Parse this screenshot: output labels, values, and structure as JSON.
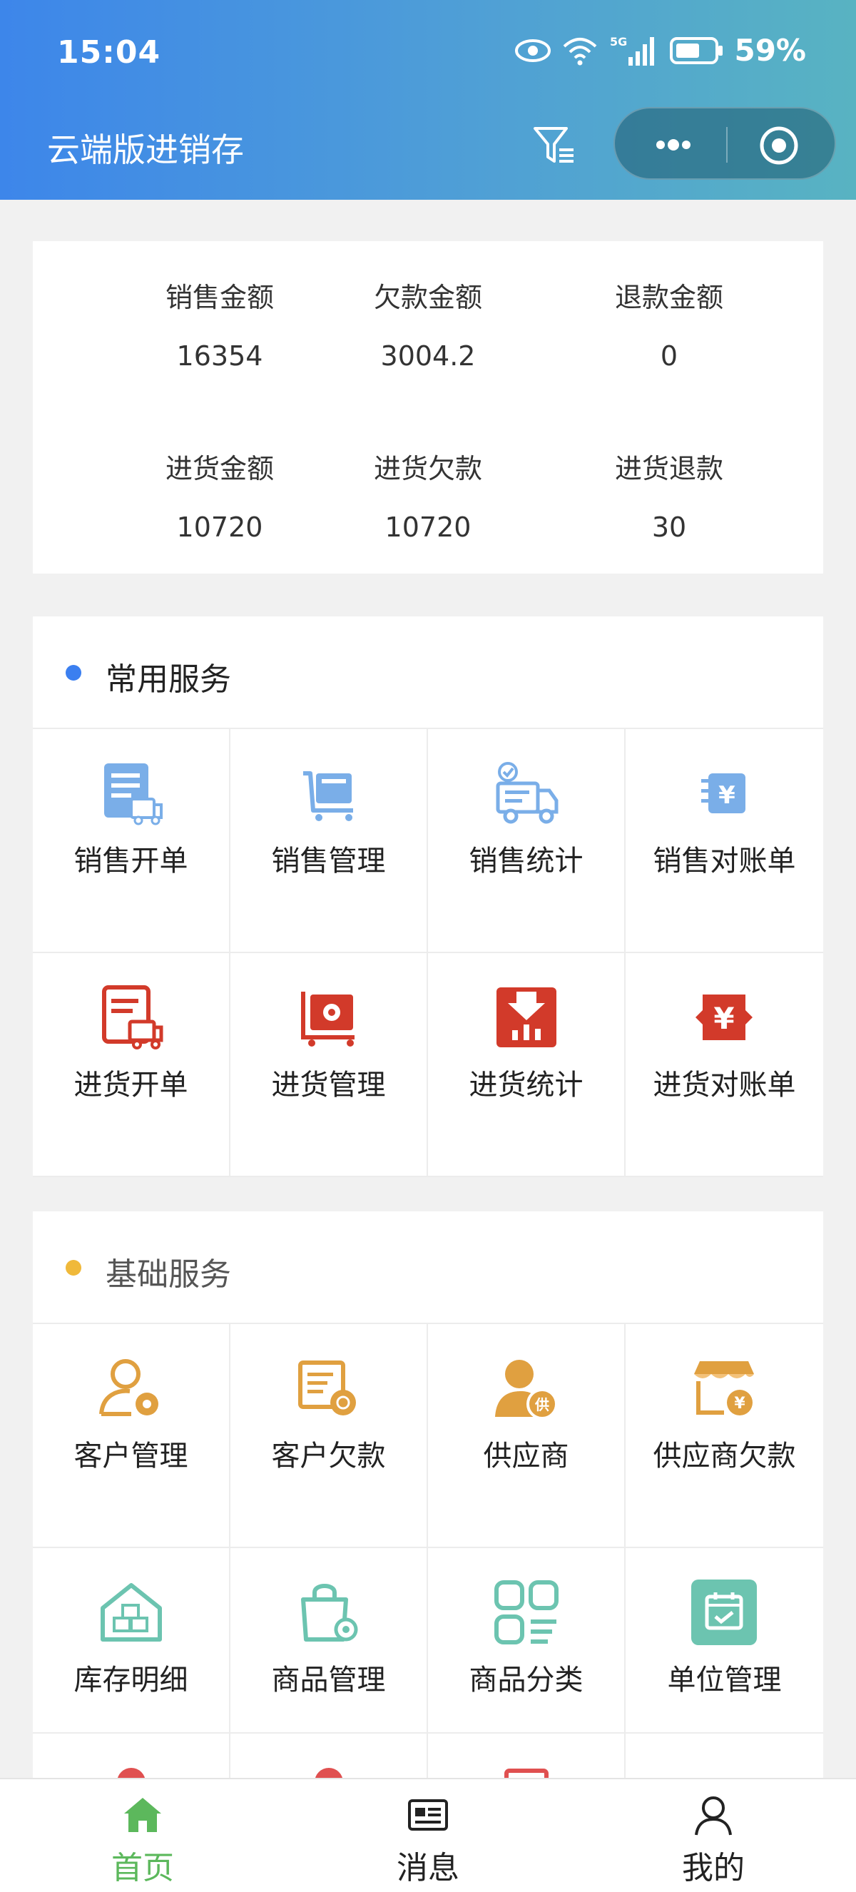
{
  "status_bar": {
    "time": "15:04",
    "battery": "59%"
  },
  "header": {
    "title": "云端版进销存"
  },
  "stats": [
    {
      "label": "销售金额",
      "value": "16354"
    },
    {
      "label": "欠款金额",
      "value": "3004.2"
    },
    {
      "label": "退款金额",
      "value": "0"
    },
    {
      "label": "进货金额",
      "value": "10720"
    },
    {
      "label": "进货欠款",
      "value": "10720"
    },
    {
      "label": "进货退款",
      "value": "30"
    }
  ],
  "common_services": {
    "title": "常用服务",
    "dot_color": "#3b7ff0",
    "items": [
      {
        "label": "销售开单",
        "icon": "sales-order-icon"
      },
      {
        "label": "销售管理",
        "icon": "cart-icon"
      },
      {
        "label": "销售统计",
        "icon": "delivery-truck-icon"
      },
      {
        "label": "销售对账单",
        "icon": "yen-statement-icon"
      },
      {
        "label": "进货开单",
        "icon": "purchase-order-icon"
      },
      {
        "label": "进货管理",
        "icon": "purchase-manage-icon"
      },
      {
        "label": "进货统计",
        "icon": "purchase-stats-icon"
      },
      {
        "label": "进货对账单",
        "icon": "yen-reconcile-icon"
      }
    ]
  },
  "basic_services": {
    "title": "基础服务",
    "dot_color": "#f0b93a",
    "items": [
      {
        "label": "客户管理",
        "icon": "customer-gear-icon"
      },
      {
        "label": "客户欠款",
        "icon": "customer-debt-icon"
      },
      {
        "label": "供应商",
        "icon": "supplier-icon"
      },
      {
        "label": "供应商欠款",
        "icon": "supplier-debt-icon"
      },
      {
        "label": "库存明细",
        "icon": "warehouse-icon"
      },
      {
        "label": "商品管理",
        "icon": "bag-gear-icon"
      },
      {
        "label": "商品分类",
        "icon": "category-grid-icon"
      },
      {
        "label": "单位管理",
        "icon": "calendar-check-icon"
      }
    ]
  },
  "tabbar": {
    "items": [
      {
        "label": "首页",
        "icon": "home-icon",
        "active": true
      },
      {
        "label": "消息",
        "icon": "message-icon",
        "active": false
      },
      {
        "label": "我的",
        "icon": "user-icon",
        "active": false
      }
    ],
    "active_color": "#5cb85c"
  },
  "colors": {
    "sales_blue": "#7aaee8",
    "purchase_red": "#d23a2a",
    "basic_gold": "#e0a040",
    "basic_teal": "#6cc4b0"
  }
}
